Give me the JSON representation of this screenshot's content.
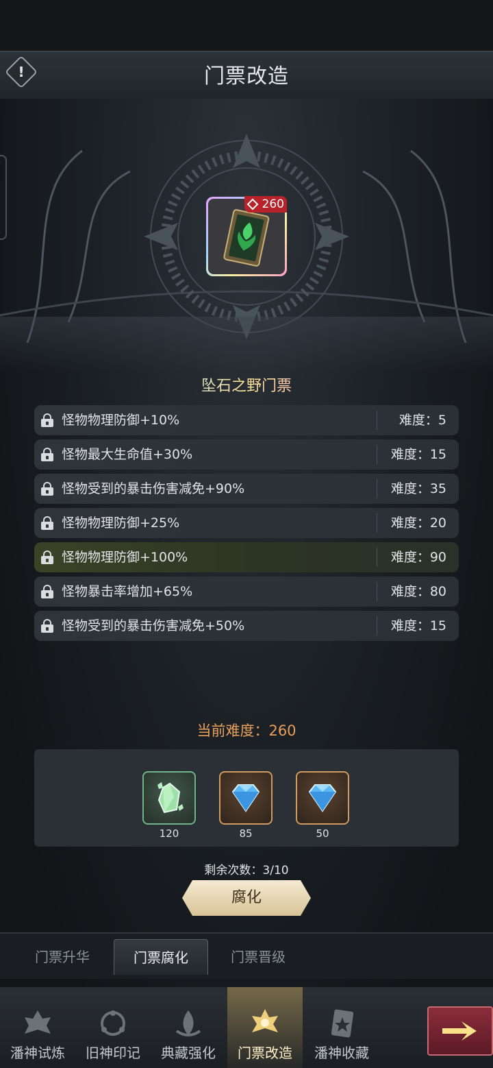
{
  "header": {
    "title": "门票改造",
    "info_icon": "exclamation-icon",
    "info_glyph": "!"
  },
  "ticket": {
    "name": "坠石之野门票",
    "difficulty_badge": "260",
    "badge_icon": "diamond-icon",
    "card_icon": "green-flame-ticket-icon"
  },
  "modifiers": [
    {
      "text": "怪物物理防御+10%",
      "difficulty": "难度：5",
      "highlighted": false
    },
    {
      "text": "怪物最大生命值+30%",
      "difficulty": "难度：15",
      "highlighted": false
    },
    {
      "text": "怪物受到的暴击伤害减免+90%",
      "difficulty": "难度：35",
      "highlighted": false
    },
    {
      "text": "怪物物理防御+25%",
      "difficulty": "难度：20",
      "highlighted": false
    },
    {
      "text": "怪物物理防御+100%",
      "difficulty": "难度：90",
      "highlighted": true
    },
    {
      "text": "怪物暴击率增加+65%",
      "difficulty": "难度：80",
      "highlighted": false
    },
    {
      "text": "怪物受到的暴击伤害减免+50%",
      "difficulty": "难度：15",
      "highlighted": false
    }
  ],
  "current_difficulty": "当前难度：260",
  "costs": [
    {
      "icon": "green-crystal-icon",
      "qty": "120"
    },
    {
      "icon": "blue-diamond-icon",
      "qty": "85"
    },
    {
      "icon": "blue-diamond-icon",
      "qty": "50"
    }
  ],
  "remaining": "剩余次数：3/10",
  "action": {
    "label": "腐化"
  },
  "subtabs": [
    {
      "label": "门票升华",
      "active": false
    },
    {
      "label": "门票腐化",
      "active": true
    },
    {
      "label": "门票晋级",
      "active": false
    }
  ],
  "bottom_nav": [
    {
      "label": "潘神试炼",
      "icon": "crest-icon",
      "active": false
    },
    {
      "label": "旧神印记",
      "icon": "sigil-icon",
      "active": false
    },
    {
      "label": "典藏强化",
      "icon": "flame-emblem-icon",
      "active": false
    },
    {
      "label": "门票改造",
      "icon": "golden-crest-icon",
      "active": true
    },
    {
      "label": "潘神收藏",
      "icon": "star-card-icon",
      "active": false
    }
  ],
  "next_icon": "arrow-right-icon",
  "colors": {
    "accent_orange": "#e8a15a",
    "highlight_row": "#3a4326",
    "badge_red": "#b8232b",
    "button_gold": "#e8dcb8"
  }
}
